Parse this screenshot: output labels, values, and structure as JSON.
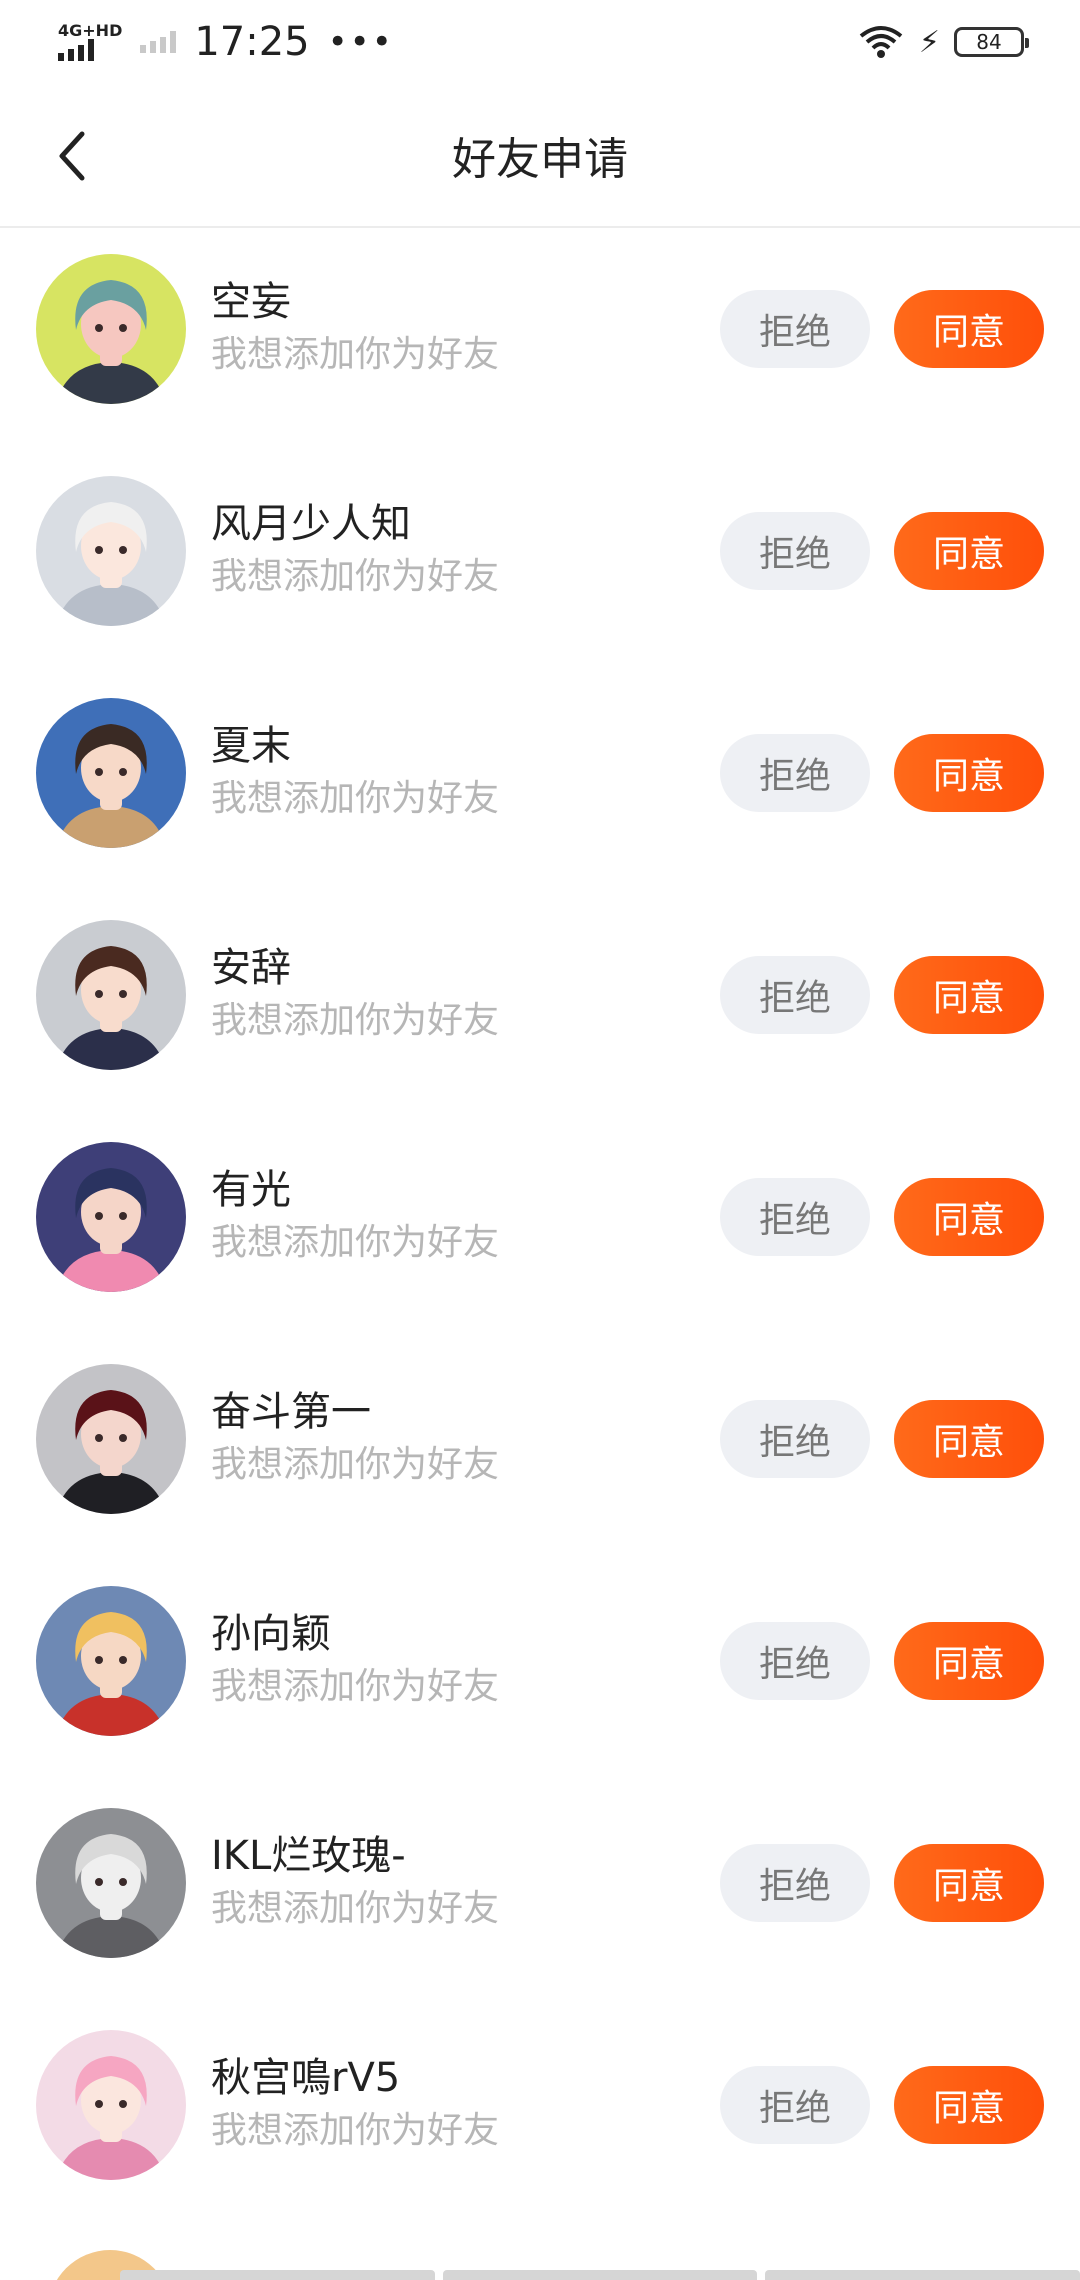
{
  "status_bar": {
    "network": "4G+HD",
    "time": "17:25",
    "more": "•••",
    "battery": "84"
  },
  "nav": {
    "title": "好友申请"
  },
  "requests": [
    {
      "name": "空妄",
      "message": "我想添加你为好友",
      "reject": "拒绝",
      "accept": "同意",
      "avatar_bg": "#d7e462",
      "hair": "#6aa0a0",
      "skin": "#f6c7c0",
      "cloth": "#333a48"
    },
    {
      "name": "风月少人知",
      "message": "我想添加你为好友",
      "reject": "拒绝",
      "accept": "同意",
      "avatar_bg": "#d9dde3",
      "hair": "#f0f0f0",
      "skin": "#fbe7dd",
      "cloth": "#b7bec9"
    },
    {
      "name": "夏末",
      "message": "我想添加你为好友",
      "reject": "拒绝",
      "accept": "同意",
      "avatar_bg": "#3f6fb8",
      "hair": "#3a2a24",
      "skin": "#f7d9c8",
      "cloth": "#c9a070"
    },
    {
      "name": "安辞",
      "message": "我想添加你为好友",
      "reject": "拒绝",
      "accept": "同意",
      "avatar_bg": "#c9ccd1",
      "hair": "#4a2a20",
      "skin": "#f8dccd",
      "cloth": "#2b2f4a"
    },
    {
      "name": "有光",
      "message": "我想添加你为好友",
      "reject": "拒绝",
      "accept": "同意",
      "avatar_bg": "#3e3f78",
      "hair": "#2a3360",
      "skin": "#f5d5c8",
      "cloth": "#f08ab0"
    },
    {
      "name": "奋斗第一",
      "message": "我想添加你为好友",
      "reject": "拒绝",
      "accept": "同意",
      "avatar_bg": "#c3c3c7",
      "hair": "#5a1218",
      "skin": "#f4d6cc",
      "cloth": "#1f1f24"
    },
    {
      "name": "孙向颖",
      "message": "我想添加你为好友",
      "reject": "拒绝",
      "accept": "同意",
      "avatar_bg": "#6e89b4",
      "hair": "#f0c060",
      "skin": "#f6d8c4",
      "cloth": "#c8312a"
    },
    {
      "name": "IKL烂玫瑰-",
      "message": "我想添加你为好友",
      "reject": "拒绝",
      "accept": "同意",
      "avatar_bg": "#8d8f93",
      "hair": "#d9d9d9",
      "skin": "#efefef",
      "cloth": "#5e5e62"
    },
    {
      "name": "秋宫鳴rV5",
      "message": "我想添加你为好友",
      "reject": "拒绝",
      "accept": "同意",
      "avatar_bg": "#f3dbe6",
      "hair": "#f6a6c2",
      "skin": "#fbe6de",
      "cloth": "#e58bb0"
    }
  ]
}
